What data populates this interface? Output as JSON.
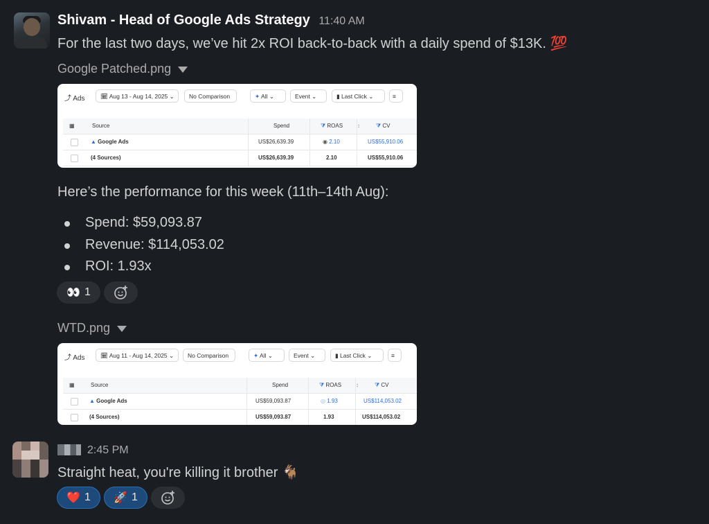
{
  "message1": {
    "author": "Shivam - Head of Google Ads Strategy",
    "time": "11:40 AM",
    "text": "For the last two days, we’ve hit 2x ROI back-to-back with a daily spend of $13K.",
    "emoji": "💯",
    "files": [
      {
        "name": "Google Patched.png",
        "toolbar": {
          "ads_label": "Ads",
          "date_range": "Aug 13 - Aug 14, 2025",
          "comparison": "No Comparison",
          "filter": "All",
          "event": "Event",
          "attribution": "Last Click"
        },
        "table": {
          "headers": {
            "source": "Source",
            "spend": "Spend",
            "roas": "ROAS",
            "cv": "CV"
          },
          "rows": [
            {
              "source": "Google Ads",
              "spend": "US$26,639.39",
              "roas": "2.10",
              "cv": "US$55,910.06"
            },
            {
              "source": "(4 Sources)",
              "spend": "US$26,639.39",
              "roas": "2.10",
              "cv": "US$55,910.06"
            }
          ]
        }
      },
      {
        "name": "WTD.png",
        "toolbar": {
          "ads_label": "Ads",
          "date_range": "Aug 11 - Aug 14, 2025",
          "comparison": "No Comparison",
          "filter": "All",
          "event": "Event",
          "attribution": "Last Click"
        },
        "table": {
          "headers": {
            "source": "Source",
            "spend": "Spend",
            "roas": "ROAS",
            "cv": "CV"
          },
          "rows": [
            {
              "source": "Google Ads",
              "spend": "US$59,093.87",
              "roas": "1.93",
              "cv": "US$114,053.02"
            },
            {
              "source": "(4 Sources)",
              "spend": "US$59,093.87",
              "roas": "1.93",
              "cv": "US$114,053.02"
            }
          ]
        }
      }
    ],
    "performance_intro": "Here’s the performance for this week (11th–14th Aug):",
    "bullets": [
      "Spend: $59,093.87",
      "Revenue: $114,053.02",
      "ROI: 1.93x"
    ],
    "reactions": [
      {
        "emoji": "👀",
        "count": "1"
      }
    ]
  },
  "message2": {
    "time": "2:45 PM",
    "text": "Straight heat, you're killing it brother",
    "emoji": "🐐",
    "reactions": [
      {
        "emoji": "❤️",
        "count": "1"
      },
      {
        "emoji": "🚀",
        "count": "1"
      }
    ]
  },
  "colors": {
    "background": "#1a1d21",
    "accent_blue": "#2b6be6",
    "selected_reaction": "#1d4a7a"
  }
}
